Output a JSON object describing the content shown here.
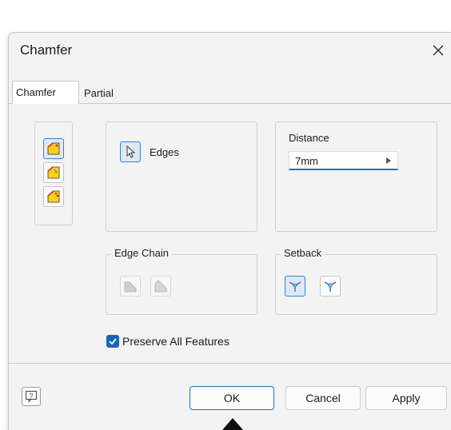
{
  "window": {
    "title": "Chamfer"
  },
  "tabs": [
    {
      "label": "Chamfer",
      "active": true
    },
    {
      "label": "Partial",
      "active": false
    }
  ],
  "method_buttons": [
    {
      "icon": "chamfer-distance-icon",
      "selected": true
    },
    {
      "icon": "chamfer-distance-angle-icon",
      "selected": false
    },
    {
      "icon": "chamfer-two-distances-icon",
      "selected": false
    }
  ],
  "edges": {
    "label": "Edges",
    "icon": "select-arrow-icon"
  },
  "distance": {
    "label": "Distance",
    "value": "7mm"
  },
  "edge_chain": {
    "label": "Edge Chain"
  },
  "setback": {
    "label": "Setback"
  },
  "preserve": {
    "label": "Preserve All Features",
    "checked": true
  },
  "buttons": {
    "ok": "OK",
    "cancel": "Cancel",
    "apply": "Apply"
  },
  "colors": {
    "accent": "#1565c0",
    "chamfer_face": "#f7d21a",
    "marker": "#e02020"
  }
}
